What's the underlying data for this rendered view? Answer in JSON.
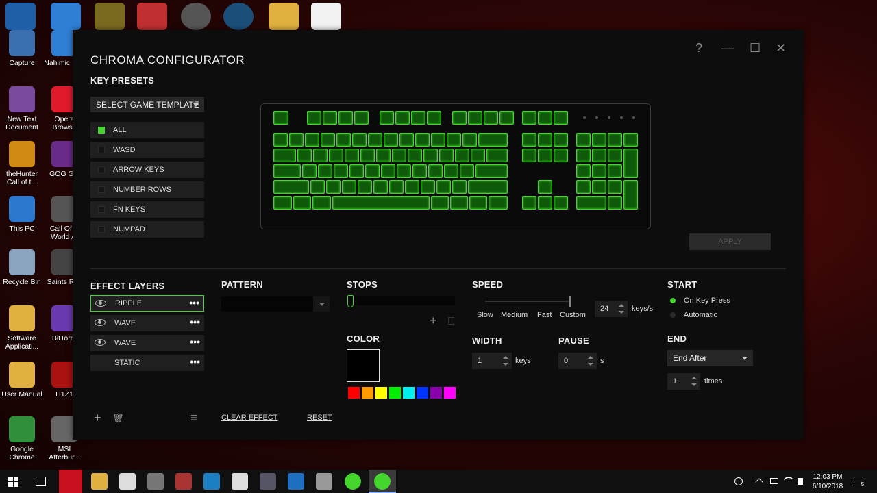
{
  "desktop_icons": [
    {
      "label": "Capture",
      "color": "#3a6fb0"
    },
    {
      "label": "Nahimic MSI",
      "color": "#2f7fd6"
    },
    {
      "label": "New Text Document",
      "color": "#7a4aa0"
    },
    {
      "label": "Opera Browse",
      "color": "#e01a2b"
    },
    {
      "label": "theHunter Call of t...",
      "color": "#d28a12"
    },
    {
      "label": "GOG Gal",
      "color": "#6a2a8a"
    },
    {
      "label": "This PC",
      "color": "#2b78d0"
    },
    {
      "label": "Call Of D World At",
      "color": "#555555"
    },
    {
      "label": "Recycle Bin",
      "color": "#8aa4c0"
    },
    {
      "label": "Saints Rov",
      "color": "#444444"
    },
    {
      "label": "Software Applicati...",
      "color": "#e0b040"
    },
    {
      "label": "BitTorre",
      "color": "#6a3ab0"
    },
    {
      "label": "User Manual",
      "color": "#e0b040"
    },
    {
      "label": "H1Z1",
      "color": "#aa1111"
    },
    {
      "label": "Google Chrome",
      "color": "#2f8f3a"
    },
    {
      "label": "MSI Afterbur...",
      "color": "#666666"
    }
  ],
  "window": {
    "title": "CHROMA CONFIGURATOR",
    "help": "?",
    "minimize": "—",
    "maximize": "☐",
    "close": "✕"
  },
  "key_presets": {
    "label": "KEY PRESETS",
    "template_dropdown": "SELECT GAME TEMPLATE",
    "items": [
      {
        "label": "ALL",
        "checked": true
      },
      {
        "label": "WASD",
        "checked": false
      },
      {
        "label": "ARROW KEYS",
        "checked": false
      },
      {
        "label": "NUMBER ROWS",
        "checked": false
      },
      {
        "label": "FN KEYS",
        "checked": false
      },
      {
        "label": "NUMPAD",
        "checked": false
      }
    ]
  },
  "apply_label": "APPLY",
  "effect_layers": {
    "label": "EFFECT LAYERS",
    "items": [
      {
        "label": "RIPPLE",
        "selected": true,
        "visible": true
      },
      {
        "label": "WAVE",
        "selected": false,
        "visible": true
      },
      {
        "label": "WAVE",
        "selected": false,
        "visible": true
      },
      {
        "label": "STATIC",
        "selected": false,
        "visible": false
      }
    ],
    "more": "•••",
    "add": "+",
    "delete": "🗑",
    "menu": "≡"
  },
  "pattern": {
    "label": "PATTERN",
    "value": ""
  },
  "stops": {
    "label": "STOPS",
    "add": "+"
  },
  "color": {
    "label": "COLOR",
    "current": "#000000",
    "palette": [
      "#ff0000",
      "#ff9900",
      "#ffff00",
      "#00ee00",
      "#00eeee",
      "#0033ff",
      "#8800aa",
      "#ff00ff"
    ]
  },
  "speed": {
    "label": "SPEED",
    "options": [
      "Slow",
      "Medium",
      "Fast",
      "Custom"
    ],
    "selected": "Custom",
    "value": "24",
    "unit": "keys/s"
  },
  "width": {
    "label": "WIDTH",
    "value": "1",
    "unit": "keys"
  },
  "pause": {
    "label": "PAUSE",
    "value": "0",
    "unit": "s"
  },
  "start": {
    "label": "START",
    "options": [
      {
        "label": "On Key Press",
        "selected": true
      },
      {
        "label": "Automatic",
        "selected": false
      }
    ]
  },
  "end": {
    "label": "END",
    "dropdown": "End After",
    "value": "1",
    "unit": "times"
  },
  "actions": {
    "clear": "CLEAR EFFECT",
    "reset": "RESET"
  },
  "taskbar": {
    "time": "12:03 PM",
    "date": "6/10/2018",
    "notification_count": "5"
  }
}
